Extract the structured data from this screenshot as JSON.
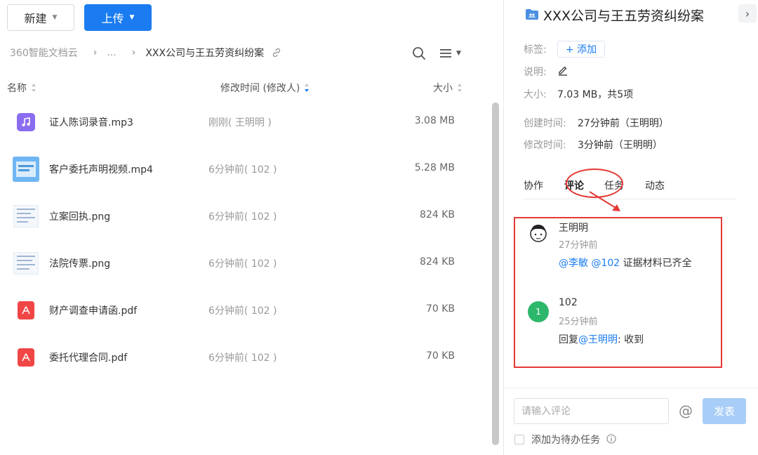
{
  "toolbar": {
    "new_label": "新建",
    "upload_label": "上传"
  },
  "breadcrumb": {
    "root": "360智能文档云",
    "ellipsis": "...",
    "current": "XXX公司与王五劳资纠纷案"
  },
  "columns": {
    "name": "名称",
    "modified": "修改时间 (修改人)",
    "size": "大小"
  },
  "files": [
    {
      "name": "证人陈词录音.mp3",
      "modified": "刚刚( 王明明 )",
      "size": "3.08 MB",
      "icon": "audio-file-icon"
    },
    {
      "name": "客户委托声明视频.mp4",
      "modified": "6分钟前( 102 )",
      "size": "5.28 MB",
      "icon": "video-thumbnail"
    },
    {
      "name": "立案回执.png",
      "modified": "6分钟前( 102 )",
      "size": "824 KB",
      "icon": "image-thumbnail"
    },
    {
      "name": "法院传票.png",
      "modified": "6分钟前( 102 )",
      "size": "824 KB",
      "icon": "image-thumbnail"
    },
    {
      "name": "财产调查申请函.pdf",
      "modified": "6分钟前( 102 )",
      "size": "70 KB",
      "icon": "pdf-file-icon"
    },
    {
      "name": "委托代理合同.pdf",
      "modified": "6分钟前( 102 )",
      "size": "70 KB",
      "icon": "pdf-file-icon"
    }
  ],
  "detail": {
    "title": "XXX公司与王五劳资纠纷案",
    "tag_label": "标签:",
    "tag_add": "+ 添加",
    "desc_label": "说明:",
    "size_label": "大小:",
    "size_value": "7.03 MB，共5项",
    "created_label": "创建时间:",
    "created_value": "27分钟前（王明明）",
    "modified_label": "修改时间:",
    "modified_value": "3分钟前（王明明）",
    "tabs": [
      "协作",
      "评论",
      "任务",
      "动态"
    ],
    "active_tab": "评论"
  },
  "comments": [
    {
      "author": "王明明",
      "time": "27分钟前",
      "mention1": "@李敏",
      "mention2": "@102",
      "text": "证据材料已齐全"
    },
    {
      "author": "102",
      "avatar_text": "1",
      "time": "25分钟前",
      "prefix": "回复",
      "mention": "@王明明",
      "text": ": 收到"
    }
  ],
  "composer": {
    "placeholder": "请输入评论",
    "at_symbol": "@",
    "submit_label": "发表",
    "todo_label": "添加为待办任务"
  },
  "colors": {
    "primary": "#1a7cf0",
    "highlight": "#e53935",
    "avatar_green": "#2db76b"
  }
}
